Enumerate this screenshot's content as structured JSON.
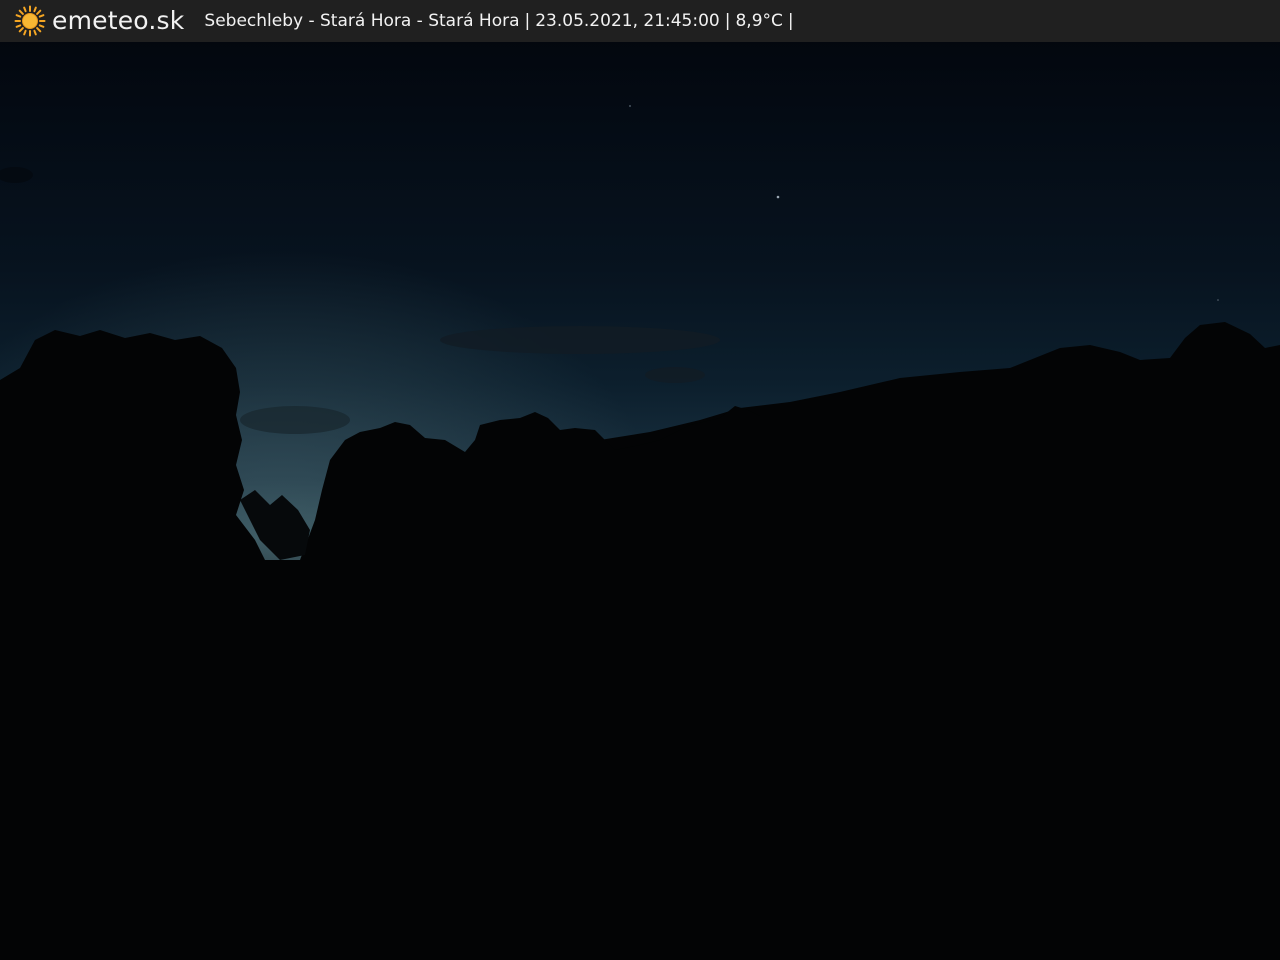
{
  "header": {
    "brand": "emeteo.sk",
    "location": "Sebechleby - Stará Hora - Stará Hora",
    "separator": "|",
    "datetime": "23.05.2021, 21:45:00",
    "temperature": "8,9°C",
    "logo_icon": "sun-icon"
  },
  "webcam": {
    "scene": "night sky over tree silhouettes",
    "colors": {
      "sky_top": "#02060d",
      "sky_mid": "#0a1d2c",
      "horizon": "#2d4653",
      "ground": "#030405",
      "accent": "#f5a623"
    }
  }
}
